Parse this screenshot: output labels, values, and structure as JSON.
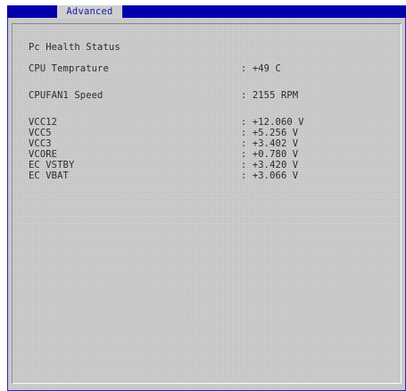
{
  "header": {
    "active_tab": "Advanced"
  },
  "section": {
    "title": "Pc Health Status"
  },
  "readings": {
    "cpu_temp": {
      "label": "CPU Temprature",
      "value": ": +49 C"
    },
    "cpufan1_speed": {
      "label": "CPUFAN1 Speed",
      "value": ": 2155 RPM"
    },
    "vcc12": {
      "label": "VCC12",
      "value": ": +12.060 V"
    },
    "vcc5": {
      "label": "VCC5",
      "value": ": +5.256 V"
    },
    "vcc3": {
      "label": "VCC3",
      "value": ": +3.402 V"
    },
    "vcore": {
      "label": "VCORE",
      "value": ": +0.780 V"
    },
    "ec_vstby": {
      "label": "EC VSTBY",
      "value": ": +3.420 V"
    },
    "ec_vbat": {
      "label": "EC VBAT",
      "value": ": +3.066 V"
    }
  },
  "colors": {
    "title_bar": "#0000aa",
    "panel_background": "#c8c8c8",
    "text": "#2c2c2c"
  }
}
